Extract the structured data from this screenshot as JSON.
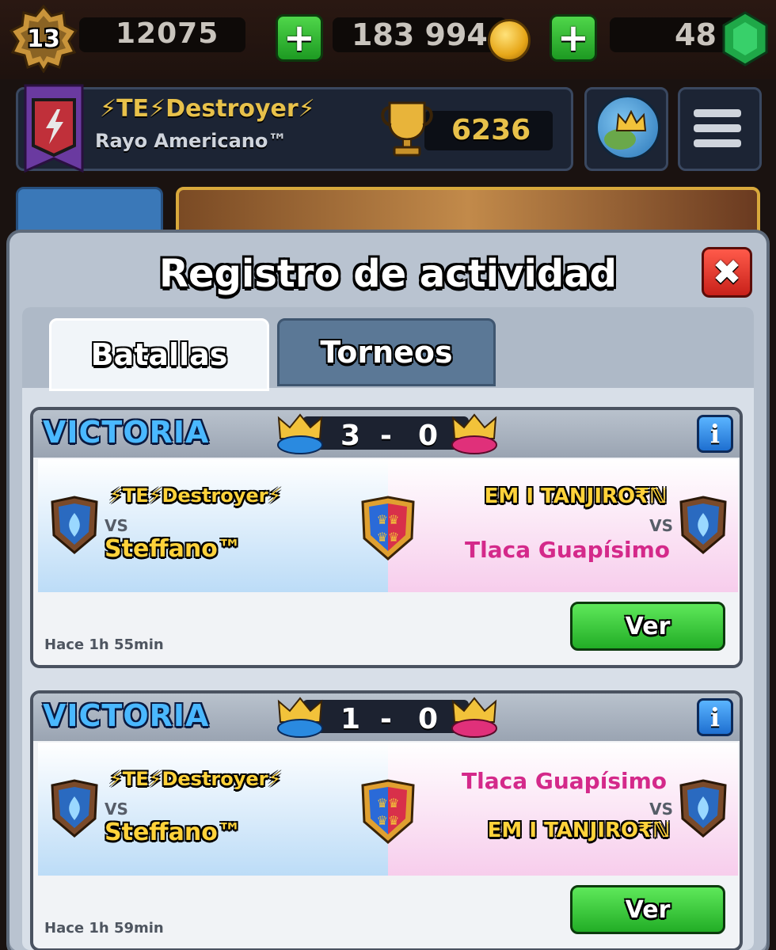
{
  "top_bar": {
    "level": "13",
    "xp": "12075",
    "gold": "183 994",
    "gems": "48",
    "add_gold_label": "+",
    "add_gems_label": "+"
  },
  "player": {
    "name": "⚡TE⚡Destroyer⚡",
    "clan": "Rayo Americano™",
    "trophies": "6236"
  },
  "modal": {
    "title": "Registro de actividad",
    "close_label": "✖",
    "tabs": [
      {
        "label": "Batallas",
        "active": true
      },
      {
        "label": "Torneos",
        "active": false
      }
    ]
  },
  "battles": [
    {
      "result": "VICTORIA",
      "score_left": "3",
      "score_sep": "-",
      "score_right": "0",
      "info_label": "i",
      "team_left": {
        "player1": "⚡TE⚡Destroyer⚡",
        "vs": "VS",
        "player2": "Steffano™"
      },
      "team_right": {
        "player1": "EM I TANJIRO₹ℕ",
        "vs": "VS",
        "player2": "Tlaca Guapísimo"
      },
      "time": "Hace 1h 55min",
      "view_label": "Ver"
    },
    {
      "result": "VICTORIA",
      "score_left": "1",
      "score_sep": "-",
      "score_right": "0",
      "info_label": "i",
      "team_left": {
        "player1": "⚡TE⚡Destroyer⚡",
        "vs": "VS",
        "player2": "Steffano™"
      },
      "team_right": {
        "player1": "Tlaca Guapísimo",
        "vs": "VS",
        "player2": "EM I TANJIRO₹ℕ"
      },
      "time": "Hace 1h 59min",
      "view_label": "Ver"
    }
  ],
  "colors": {
    "victory_blue": "#4ab8ff",
    "name_yellow": "#ffd23a",
    "name_pink": "#d4298a",
    "button_green": "#22ad26",
    "close_red": "#c8211a"
  }
}
